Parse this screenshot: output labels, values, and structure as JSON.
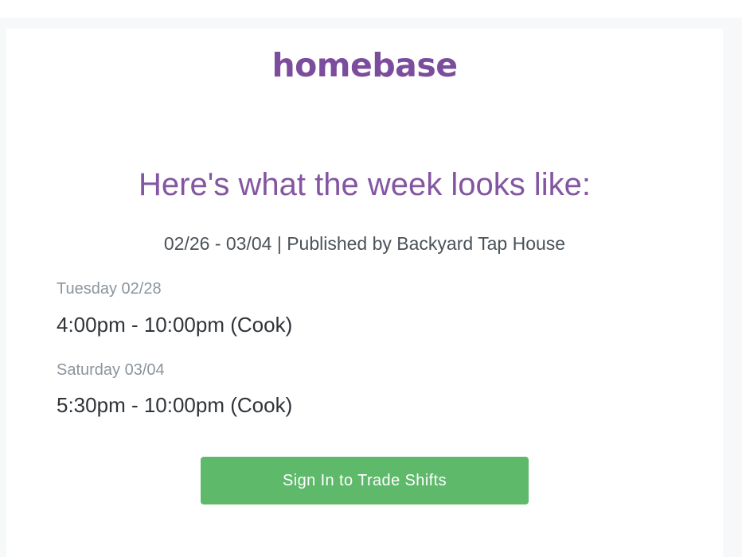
{
  "brand": {
    "logo_text": "homebase",
    "logo_color": "#7b4d9c"
  },
  "email": {
    "headline": "Here's what the week looks like:",
    "summary": "02/26 - 03/04 | Published by Backyard Tap House",
    "shifts": [
      {
        "day": "Tuesday 02/28",
        "time": "4:00pm - 10:00pm (Cook)"
      },
      {
        "day": "Saturday 03/04",
        "time": "5:30pm - 10:00pm (Cook)"
      }
    ],
    "cta_label": "Sign In to Trade Shifts",
    "cta_color": "#5fb96b"
  }
}
